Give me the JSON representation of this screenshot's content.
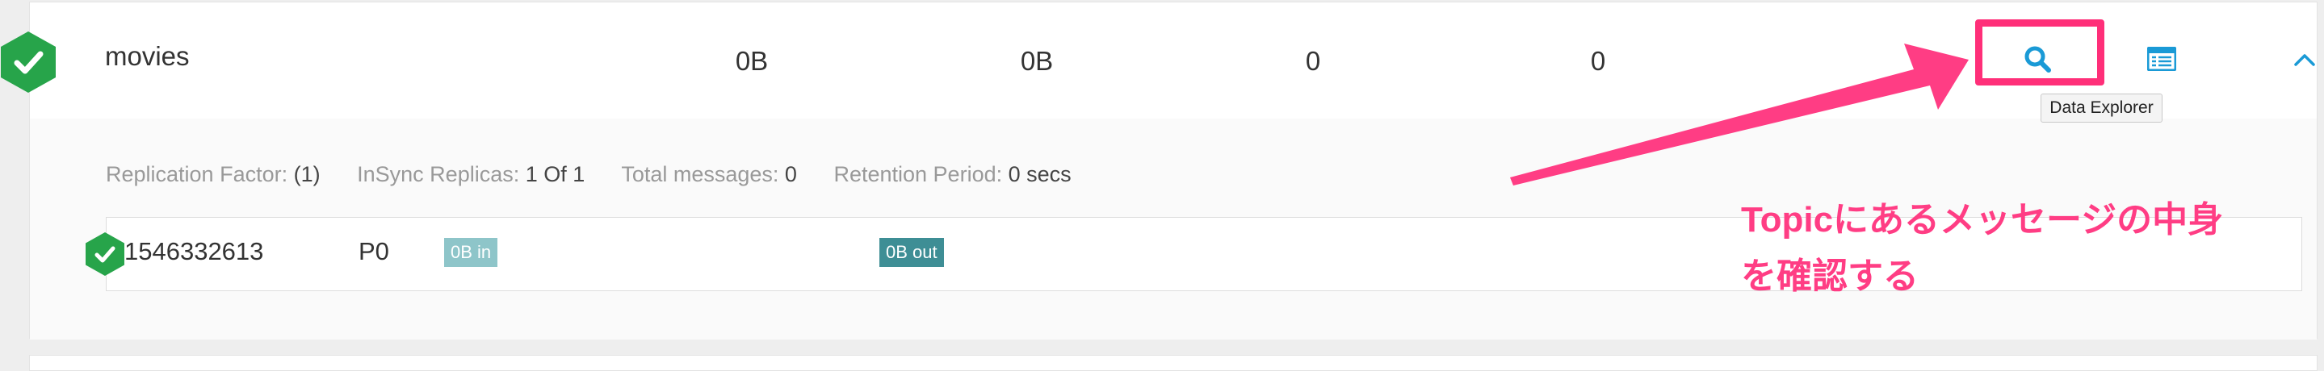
{
  "topic": {
    "name": "movies",
    "status": "healthy",
    "stats": [
      "0B",
      "0B",
      "0",
      "0"
    ]
  },
  "actions": {
    "data_explorer_icon": "search-icon",
    "topic_config_icon": "list-icon",
    "collapse_icon": "chevron-up-icon",
    "tooltip": "Data Explorer"
  },
  "details": {
    "replication_factor_label": "Replication Factor:",
    "replication_factor_value": "(1)",
    "insync_label": "InSync Replicas:",
    "insync_value": "1 Of 1",
    "total_messages_label": "Total messages:",
    "total_messages_value": "0",
    "retention_label": "Retention Period:",
    "retention_value": "0 secs"
  },
  "partition": {
    "id": "1546332613",
    "name": "P0",
    "in_badge": "0B in",
    "out_badge": "0B out"
  },
  "annotation": {
    "line1": "Topicにあるメッセージの中身",
    "line2": "を確認する"
  },
  "colors": {
    "status_green": "#27a44a",
    "accent_blue": "#1a9ad6",
    "annotation_pink": "#ff3d84",
    "badge_in": "#8ec5c9",
    "badge_out": "#3e8e95"
  }
}
